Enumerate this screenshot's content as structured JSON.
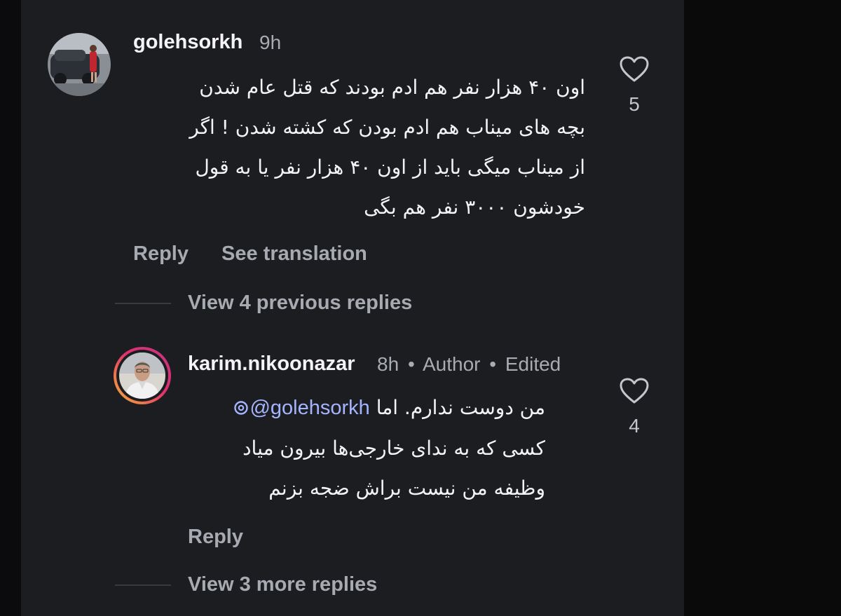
{
  "comments": [
    {
      "username": "golehsorkh",
      "time": "9h",
      "text_lines": [
        "اون ۴۰ هزار نفر هم ادم بودند که قتل عام شدن",
        "بچه های میناب هم ادم بودن که کشته شدن ! اگر",
        "از میناب میگی باید از اون ۴۰ هزار نفر یا به قول",
        "خودشون ۳۰۰۰ نفر هم بگی"
      ],
      "likes": "5",
      "reply_label": "Reply",
      "translate_label": "See translation"
    },
    {
      "username": "karim.nikoonazar",
      "time": "8h",
      "author_label": "Author",
      "edited_label": "Edited",
      "meta_separator": "•",
      "mention": "@golehsorkh",
      "line1_rest": "من دوست ندارم. اما",
      "text_lines": [
        "کسی که به ندای خارجی‌ها بیرون میاد",
        "وظیفه من نیست براش ضجه بزنم"
      ],
      "likes": "4",
      "reply_label": "Reply"
    }
  ],
  "threads": {
    "view_previous": "View 4 previous replies",
    "view_more": "View 3 more replies"
  },
  "colors": {
    "panel": "#1c1d21",
    "mention": "#a5b4ff",
    "muted": "#a8aab2",
    "story_ring_start": "#f7b733",
    "story_ring_end": "#c13584"
  },
  "icons": {
    "like": "heart-outline-icon",
    "threads_mention": "threads-at-icon"
  }
}
